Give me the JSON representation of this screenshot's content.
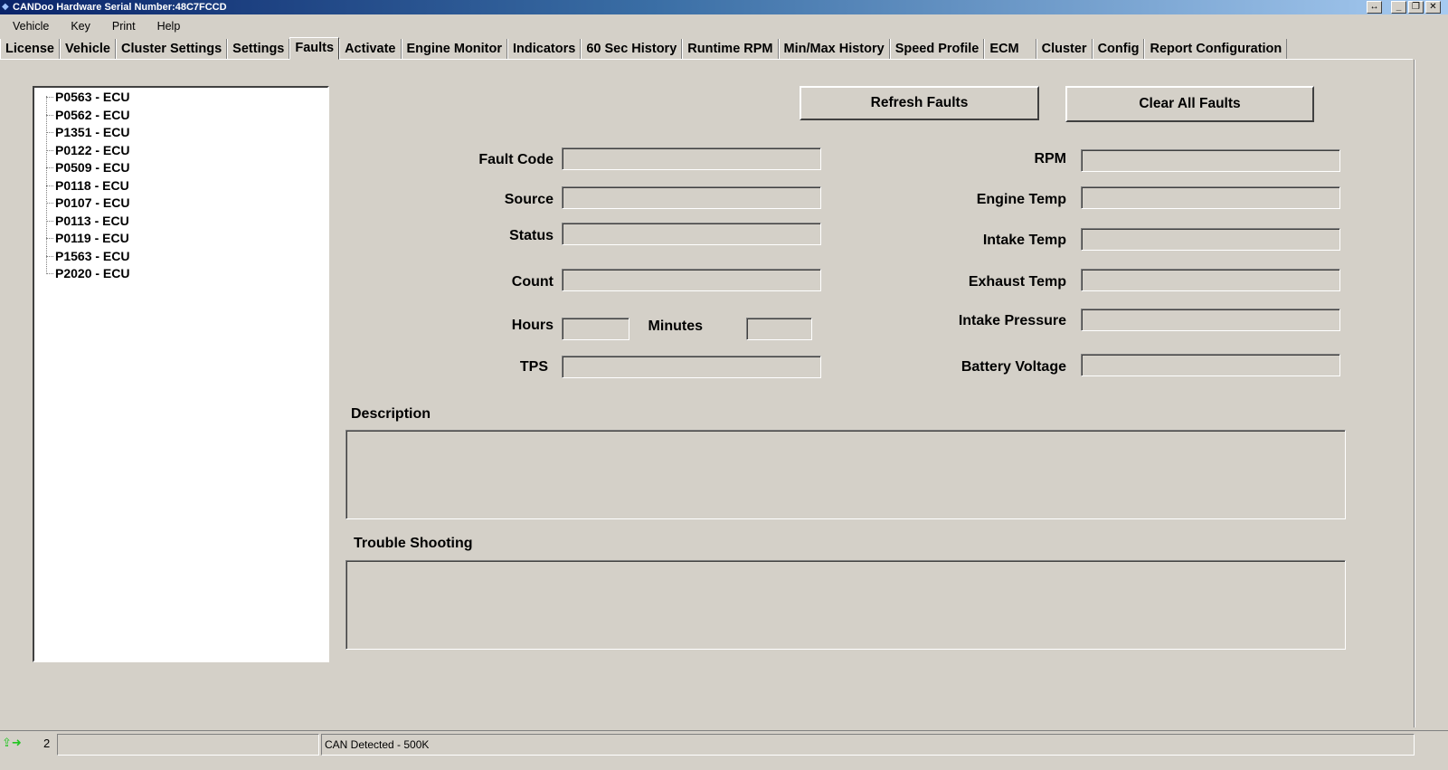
{
  "window": {
    "title": "CANDoo  Hardware Serial Number:48C7FCCD",
    "controls": [
      "↔",
      "_",
      "❐",
      "✕"
    ]
  },
  "menu": [
    "Vehicle",
    "Key",
    "Print",
    "Help"
  ],
  "tabs": [
    "License",
    "Vehicle",
    "Cluster Settings",
    "Settings",
    "Faults",
    "Activate",
    "Engine Monitor",
    "Indicators",
    "60 Sec History",
    "Runtime RPM",
    "Min/Max History",
    "Speed Profile",
    "ECM",
    "Cluster",
    "Config",
    "Report Configuration"
  ],
  "active_tab": "Faults",
  "faults": [
    "P0563 - ECU",
    "P0562 - ECU",
    "P1351 - ECU",
    "P0122 - ECU",
    "P0509 - ECU",
    "P0118 - ECU",
    "P0107 - ECU",
    "P0113 - ECU",
    "P0119 - ECU",
    "P1563 - ECU",
    "P2020 - ECU"
  ],
  "buttons": {
    "refresh": "Refresh Faults",
    "clear": "Clear All Faults"
  },
  "labels": {
    "fault_code": "Fault Code",
    "source": "Source",
    "status": "Status",
    "count": "Count",
    "hours": "Hours",
    "minutes": "Minutes",
    "tps": "TPS",
    "rpm": "RPM",
    "engine_temp": "Engine Temp",
    "intake_temp": "Intake Temp",
    "exhaust_temp": "Exhaust Temp",
    "intake_pressure": "Intake Pressure",
    "battery_voltage": "Battery Voltage",
    "description": "Description",
    "trouble_shooting": "Trouble Shooting"
  },
  "fields": {
    "fault_code": "",
    "source": "",
    "status": "",
    "count": "",
    "hours": "",
    "minutes": "",
    "tps": "",
    "rpm": "",
    "engine_temp": "",
    "intake_temp": "",
    "exhaust_temp": "",
    "intake_pressure": "",
    "battery_voltage": "",
    "description": "",
    "trouble_shooting": ""
  },
  "status_bar": {
    "icon": "connection-icon",
    "count": "2",
    "message": "CAN Detected - 500K"
  }
}
